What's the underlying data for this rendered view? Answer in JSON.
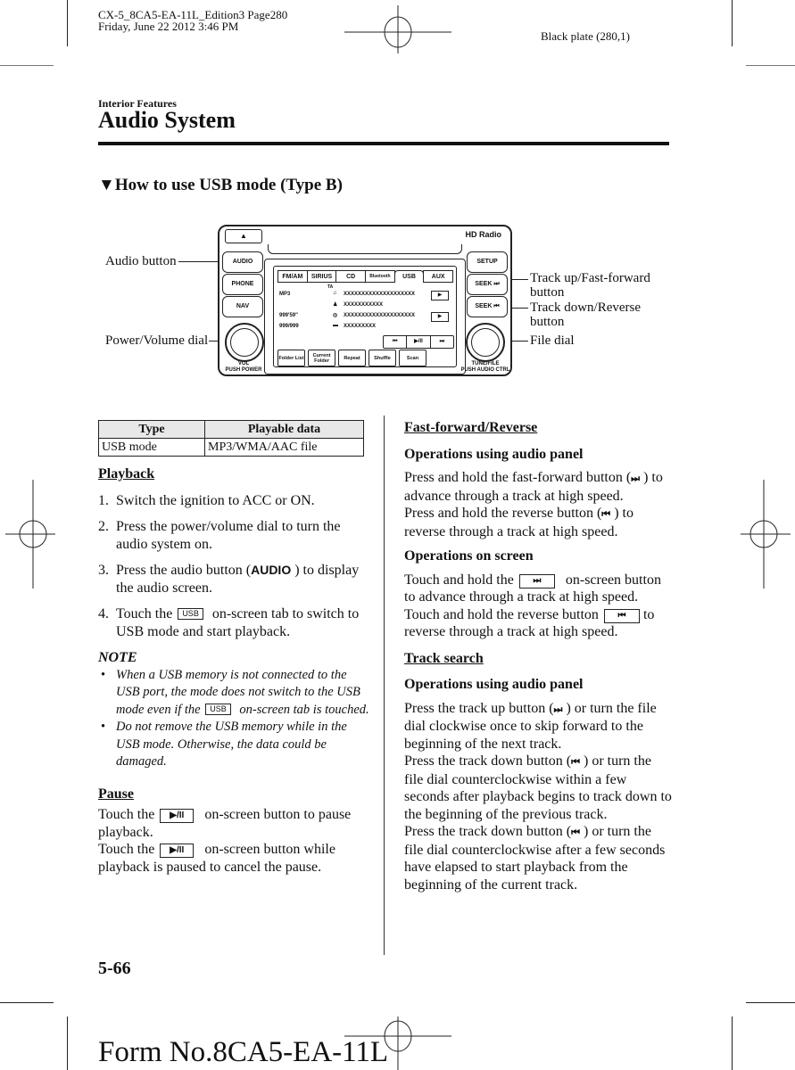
{
  "print_header": {
    "line1": "CX-5_8CA5-EA-11L_Edition3 Page280",
    "line2": "Friday, June 22 2012 3:46 PM",
    "plate": "Black plate (280,1)"
  },
  "section": "Interior Features",
  "title": "Audio System",
  "subheading": {
    "marker": "▼",
    "text": "How to use USB mode (Type B)"
  },
  "figure": {
    "callouts": {
      "audio_button": "Audio button",
      "power_volume_dial": "Power/Volume dial",
      "track_up": "Track up/Fast-forward",
      "track_up_2": "button",
      "track_down": "Track down/Reverse",
      "track_down_2": "button",
      "file_dial": "File dial"
    },
    "unit": {
      "eject": "▲",
      "hd_radio": "HD Radio",
      "left_buttons": [
        "AUDIO",
        "PHONE",
        "NAV"
      ],
      "right_buttons": [
        "SETUP",
        "SEEK ⏭",
        "SEEK ⏮"
      ],
      "vol_label": "VOL",
      "vol_sub": "PUSH POWER",
      "tune_label": "TUNE/FILE",
      "tune_sub": "PUSH AUDIO CTRL"
    },
    "screen": {
      "tabs": [
        "FM/AM",
        "SIRIUS",
        "CD",
        "Bluetooth",
        "USB",
        "AUX"
      ],
      "active_tab": "USB",
      "ta": "TA",
      "format": "MP3",
      "time": "999'59\"",
      "track_count": "999/999",
      "rows": [
        {
          "icon": "music-note",
          "glyph": "♫",
          "text": "XXXXXXXXXXXXXXXXXXXX",
          "has_play": true
        },
        {
          "icon": "artist",
          "glyph": "♟",
          "text": "XXXXXXXXXXX",
          "has_play": false
        },
        {
          "icon": "album-disc",
          "glyph": "◎",
          "text": "XXXXXXXXXXXXXXXXXXXX",
          "has_play": true
        },
        {
          "icon": "folder",
          "glyph": "▬",
          "text": "XXXXXXXXX",
          "has_play": false
        }
      ],
      "play_glyph": "▶",
      "controls": [
        "⏮",
        "▶/II",
        "⏭"
      ],
      "bottom_buttons": [
        "Folder List",
        "Current Folder",
        "Repeat",
        "Shuffle",
        "Scan"
      ]
    }
  },
  "table": {
    "headers": [
      "Type",
      "Playable data"
    ],
    "rows": [
      [
        "USB mode",
        "MP3/WMA/AAC file"
      ]
    ]
  },
  "left": {
    "playback_heading": "Playback",
    "steps": [
      {
        "num": "1.",
        "text": "Switch the ignition to ACC or ON."
      },
      {
        "num": "2.",
        "text": "Press the power/volume dial to turn the audio system on."
      },
      {
        "num": "3.",
        "pre": "Press the audio button (",
        "key": "AUDIO",
        "post": " ) to display the audio screen."
      },
      {
        "num": "4.",
        "pre": "Touch the ",
        "key": "USB",
        "post": " on-screen tab to switch to USB mode and start playback."
      }
    ],
    "note_title": "NOTE",
    "notes": [
      {
        "pre": "When a USB memory is not connected to the USB port, the mode does not switch to the USB mode even if the ",
        "key": "USB",
        "post": " on-screen tab is touched."
      },
      {
        "text": "Do not remove the USB memory while in the USB mode. Otherwise, the data could be damaged."
      }
    ],
    "pause_heading": "Pause",
    "pause": [
      {
        "pre": "Touch the ",
        "key": "▶/II",
        "post": " on-screen button to pause playback."
      },
      {
        "pre": "Touch the ",
        "key": "▶/II",
        "post": " on-screen button while playback is paused to cancel the pause."
      }
    ]
  },
  "right": {
    "ff_heading": "Fast-forward/Reverse",
    "panel_heading": "Operations using audio panel",
    "ff_panel_1_pre": "Press and hold the fast-forward button (",
    "ff_panel_1_sym": "⏭",
    "ff_panel_1_post": " ) to advance through a track at high speed.",
    "ff_panel_2_pre": "Press and hold the reverse button (",
    "ff_panel_2_sym": "⏮",
    "ff_panel_2_post": " ) to reverse through a track at high speed.",
    "screen_heading": "Operations on screen",
    "ff_screen_1_pre": "Touch and hold the ",
    "ff_screen_1_key": "⏭",
    "ff_screen_1_post": " on-screen button to advance through a track at high speed.",
    "ff_screen_2_pre": "Touch and hold the reverse button ",
    "ff_screen_2_key": "⏮",
    "ff_screen_2_post": " to reverse through a track at high speed.",
    "ts_heading": "Track search",
    "ts_panel_heading": "Operations using audio panel",
    "ts_1_pre": "Press the track up button (",
    "ts_1_sym": "⏭",
    "ts_1_post": " ) or turn the file dial clockwise once to skip forward to the beginning of the next track.",
    "ts_2_pre": "Press the track down button (",
    "ts_2_sym": "⏮",
    "ts_2_post": " ) or turn the file dial counterclockwise within a few seconds after playback begins to track down to the beginning of the previous track.",
    "ts_3_pre": "Press the track down button (",
    "ts_3_sym": "⏮",
    "ts_3_post": " ) or turn the file dial counterclockwise after a few seconds have elapsed to start playback from the beginning of the current track."
  },
  "footer": {
    "page_number": "5-66",
    "form_number": "Form No.8CA5-EA-11L"
  }
}
